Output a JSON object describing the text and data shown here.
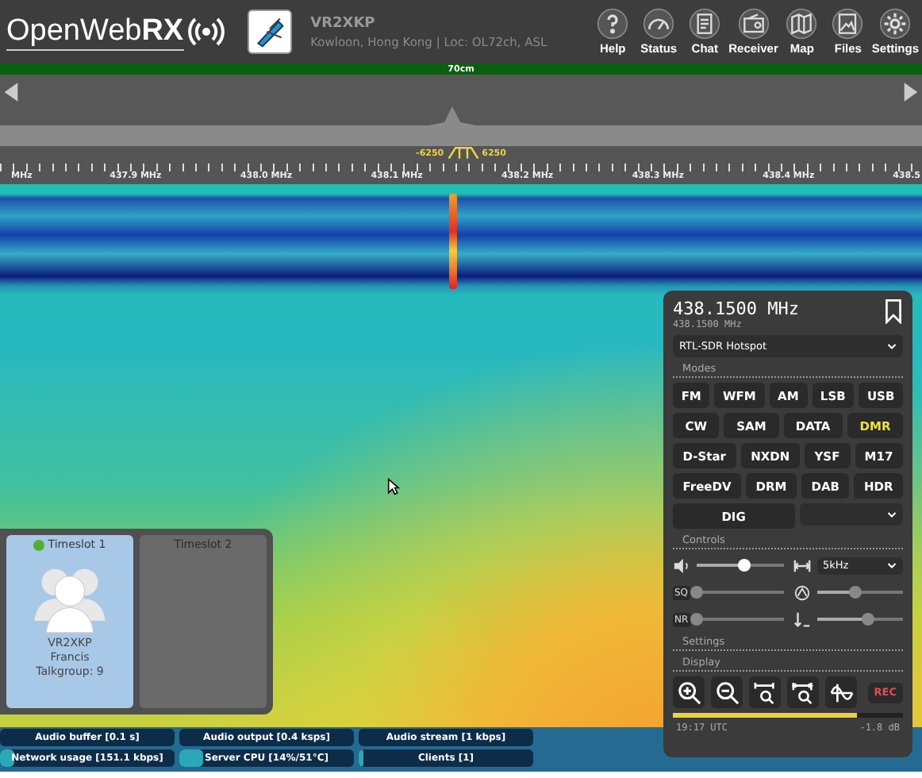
{
  "header": {
    "logo": "OpenWeb**RX**",
    "callsign": "VR2XKP",
    "location": "Kowloon, Hong Kong | Loc: OL72ch, ASL",
    "nav": [
      {
        "label": "Help",
        "kind": "help"
      },
      {
        "label": "Status",
        "kind": "status"
      },
      {
        "label": "Chat",
        "kind": "chat"
      },
      {
        "label": "Receiver",
        "kind": "receiver"
      },
      {
        "label": "Map",
        "kind": "map"
      },
      {
        "label": "Files",
        "kind": "files"
      },
      {
        "label": "Settings",
        "kind": "settings"
      }
    ]
  },
  "band": {
    "label": "70cm"
  },
  "passband": {
    "low": "-6250",
    "high": "6250"
  },
  "scale": {
    "labels": [
      "MHz",
      "437.9 MHz",
      "438.0 MHz",
      "438.1 MHz",
      "438.2 MHz",
      "438.3 MHz",
      "438.4 MHz",
      "438.5"
    ]
  },
  "timeslots": [
    {
      "title": "Timeslot 1",
      "active": true,
      "callsign": "VR2XKP",
      "name": "Francis",
      "talkgroup": "Talkgroup: 9"
    },
    {
      "title": "Timeslot 2",
      "active": false
    }
  ],
  "receiver": {
    "frequency": "438.1500 MHz",
    "frequency_small": "438.1500 MHz",
    "profile": "RTL-SDR Hotspot",
    "modes_title": "Modes",
    "modes": [
      [
        {
          "label": "FM",
          "selected": false
        },
        {
          "label": "WFM",
          "selected": false
        },
        {
          "label": "AM",
          "selected": false
        },
        {
          "label": "LSB",
          "selected": false
        },
        {
          "label": "USB",
          "selected": false
        }
      ],
      [
        {
          "label": "CW",
          "selected": false
        },
        {
          "label": "SAM",
          "selected": false
        },
        {
          "label": "DATA",
          "selected": false
        },
        {
          "label": "DMR",
          "selected": true
        }
      ],
      [
        {
          "label": "D-Star",
          "selected": false
        },
        {
          "label": "NXDN",
          "selected": false
        },
        {
          "label": "YSF",
          "selected": false
        },
        {
          "label": "M17",
          "selected": false
        }
      ],
      [
        {
          "label": "FreeDV",
          "selected": false
        },
        {
          "label": "DRM",
          "selected": false
        },
        {
          "label": "DAB",
          "selected": false
        },
        {
          "label": "HDR",
          "selected": false
        }
      ],
      [
        {
          "label": "DIG",
          "selected": false
        }
      ]
    ],
    "controls_title": "Controls",
    "controls": [
      [
        {
          "kind": "volume",
          "level": 0.55
        },
        {
          "kind": "bandwidth",
          "value": "5kHz"
        }
      ],
      [
        {
          "kind": "text",
          "label": "SQ",
          "level": 0.0
        },
        {
          "kind": "autosquelch",
          "level": 0.45
        }
      ],
      [
        {
          "kind": "text",
          "label": "NR",
          "level": 0.0
        },
        {
          "kind": "nrlevel",
          "level": 0.6
        }
      ]
    ],
    "settings_title": "Settings",
    "display_title": "Display",
    "display_buttons": [
      {
        "kind": "zoom-in"
      },
      {
        "kind": "zoom-out"
      },
      {
        "kind": "zoom-fit"
      },
      {
        "kind": "zoom-band"
      },
      {
        "kind": "wave"
      }
    ],
    "rec": "REC",
    "meter": {
      "level": 0.8
    },
    "time": "19:17 UTC",
    "db": "-1.8 dB"
  },
  "status": [
    [
      {
        "label": "Audio buffer [0.1 s]"
      },
      {
        "label": "Audio output [0.4 ksps]"
      },
      {
        "label": "Audio stream [1 kbps]"
      }
    ],
    [
      {
        "label": "Network usage [151.1 kbps]",
        "level": 0.08
      },
      {
        "label": "Server CPU [14%/51°C]",
        "level": 0.14
      },
      {
        "label": "Clients [1]",
        "level": 0.03
      }
    ]
  ]
}
